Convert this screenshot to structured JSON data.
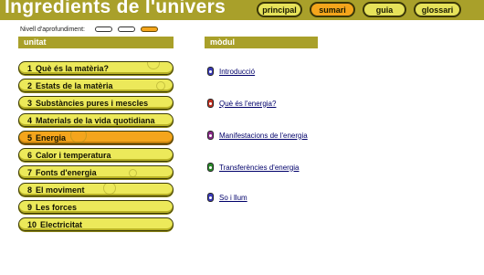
{
  "header": {
    "title": "Ingredients de l'univers",
    "nav": [
      {
        "label": "principal",
        "active": false
      },
      {
        "label": "sumari",
        "active": true
      },
      {
        "label": "guia",
        "active": false
      },
      {
        "label": "glossari",
        "active": false
      }
    ],
    "bar_color": "#a9a02a",
    "accent_color": "#f4a51c"
  },
  "level": {
    "label": "Nivell d'aprofundiment:",
    "options": [
      {
        "name": "level-1",
        "active": false
      },
      {
        "name": "level-2",
        "active": false
      },
      {
        "name": "level-3",
        "active": true
      }
    ]
  },
  "unitat": {
    "heading": "unitat",
    "items": [
      {
        "num": "1",
        "label": "Què és la matèria?",
        "active": false
      },
      {
        "num": "2",
        "label": "Estats de la matèria",
        "active": false
      },
      {
        "num": "3",
        "label": "Substàncies pures i mescles",
        "active": false
      },
      {
        "num": "4",
        "label": "Materials de la vida quotidiana",
        "active": false
      },
      {
        "num": "5",
        "label": "Energia",
        "active": true
      },
      {
        "num": "6",
        "label": "Calor i temperatura",
        "active": false
      },
      {
        "num": "7",
        "label": "Fonts d'energia",
        "active": false
      },
      {
        "num": "8",
        "label": "El moviment",
        "active": false
      },
      {
        "num": "9",
        "label": "Les forces",
        "active": false
      },
      {
        "num": "10",
        "label": "Electricitat",
        "active": false
      }
    ]
  },
  "modul": {
    "heading": "mòdul",
    "items": [
      {
        "label": "Introducció",
        "icon": "module-icon-blue",
        "color": "#3a3ab8"
      },
      {
        "label": "Què és l'energia?",
        "icon": "module-icon-red",
        "color": "#c03020"
      },
      {
        "label": "Manifestacions de l'energia",
        "icon": "module-icon-purple",
        "color": "#8a2a8a"
      },
      {
        "label": "Transferències d'energia",
        "icon": "module-icon-green",
        "color": "#2a8a2a"
      },
      {
        "label": "So i llum",
        "icon": "module-icon-blue",
        "color": "#3a3ab8"
      }
    ]
  }
}
